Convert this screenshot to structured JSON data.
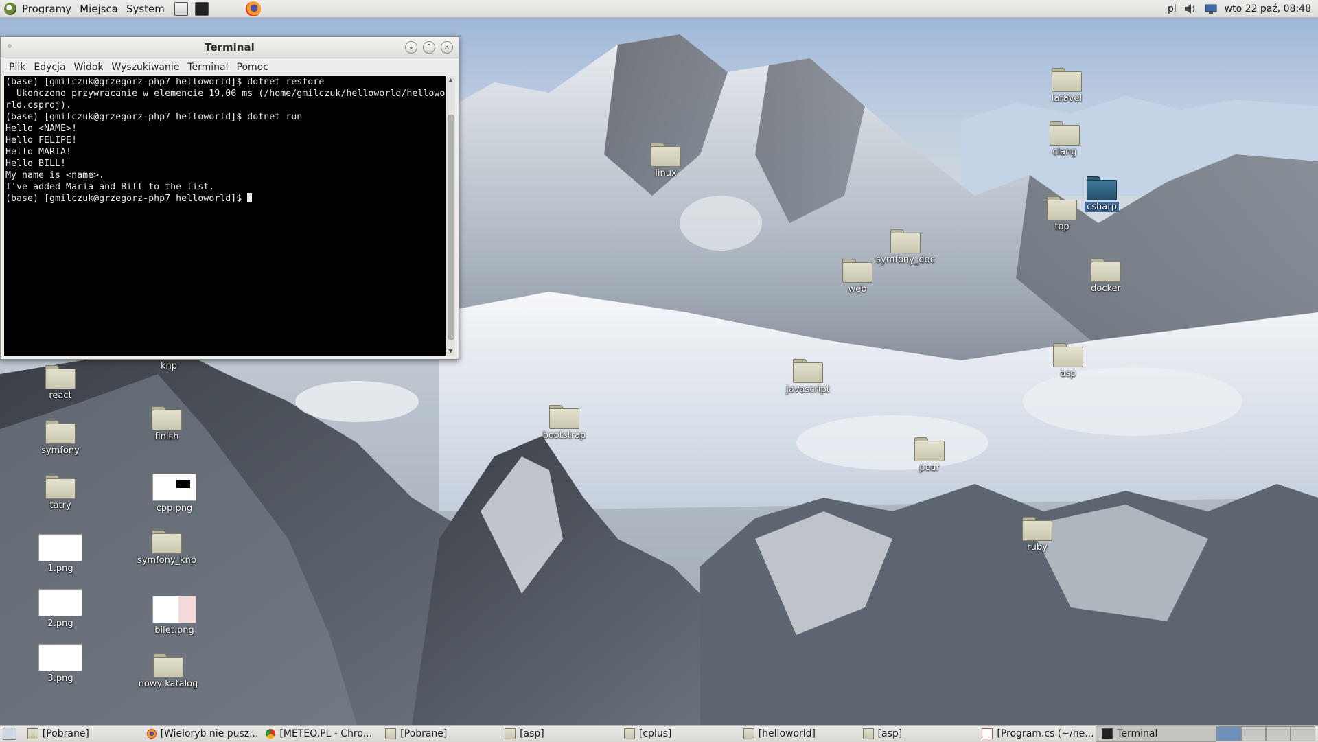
{
  "top_panel": {
    "menus": [
      "Programy",
      "Miejsca",
      "System"
    ],
    "keyboard_layout": "pl",
    "clock": "wto 22 paź, 08:48"
  },
  "desktop_icons": [
    {
      "label": "laravel",
      "kind": "folder"
    },
    {
      "label": "clang",
      "kind": "folder"
    },
    {
      "label": "linux",
      "kind": "folder"
    },
    {
      "label": "csharp",
      "kind": "folder-selected"
    },
    {
      "label": "top",
      "kind": "folder"
    },
    {
      "label": "symfony_doc",
      "kind": "folder"
    },
    {
      "label": "web",
      "kind": "folder"
    },
    {
      "label": "docker",
      "kind": "folder"
    },
    {
      "label": "asp",
      "kind": "folder"
    },
    {
      "label": "javascript",
      "kind": "folder"
    },
    {
      "label": "bootstrap",
      "kind": "folder"
    },
    {
      "label": "pear",
      "kind": "folder"
    },
    {
      "label": "ruby",
      "kind": "folder"
    },
    {
      "label": "knp",
      "kind": "folder"
    },
    {
      "label": "react",
      "kind": "folder"
    },
    {
      "label": "finish",
      "kind": "folder"
    },
    {
      "label": "symfony",
      "kind": "folder"
    },
    {
      "label": "cpp.png",
      "kind": "image"
    },
    {
      "label": "tatry",
      "kind": "folder"
    },
    {
      "label": "symfony_knp",
      "kind": "folder"
    },
    {
      "label": "1.png",
      "kind": "image"
    },
    {
      "label": "bilet.png",
      "kind": "image"
    },
    {
      "label": "2.png",
      "kind": "image"
    },
    {
      "label": "nowy katalog",
      "kind": "folder"
    },
    {
      "label": "3.png",
      "kind": "image"
    }
  ],
  "terminal": {
    "title": "Terminal",
    "menu": [
      "Plik",
      "Edycja",
      "Widok",
      "Wyszukiwanie",
      "Terminal",
      "Pomoc"
    ],
    "lines": [
      "(base) [gmilczuk@grzegorz-php7 helloworld]$ dotnet restore",
      "  Ukończono przywracanie w elemencie 19,06 ms (/home/gmilczuk/helloworld/hellowo",
      "rld.csproj).",
      "(base) [gmilczuk@grzegorz-php7 helloworld]$ dotnet run",
      "",
      "Hello <NAME>!",
      "Hello FELIPE!",
      "Hello MARIA!",
      "Hello BILL!",
      "My name is <name>.",
      "I've added Maria and Bill to the list."
    ],
    "prompt": "(base) [gmilczuk@grzegorz-php7 helloworld]$ "
  },
  "taskbar": {
    "tasks": [
      {
        "label": "[Pobrane]",
        "icon": "folder-icon"
      },
      {
        "label": "[Wieloryb nie pusz...",
        "icon": "firefox-icon"
      },
      {
        "label": "[METEO.PL - Chro...",
        "icon": "chrome-icon"
      },
      {
        "label": "[Pobrane]",
        "icon": "folder-icon"
      },
      {
        "label": "[asp]",
        "icon": "folder-icon"
      },
      {
        "label": "[cplus]",
        "icon": "folder-icon"
      },
      {
        "label": "[helloworld]",
        "icon": "folder-icon"
      },
      {
        "label": "[asp]",
        "icon": "folder-icon"
      },
      {
        "label": "[Program.cs (~/he...",
        "icon": "text-editor-icon"
      },
      {
        "label": "Terminal",
        "icon": "terminal-icon"
      }
    ],
    "active_task": "Terminal"
  }
}
